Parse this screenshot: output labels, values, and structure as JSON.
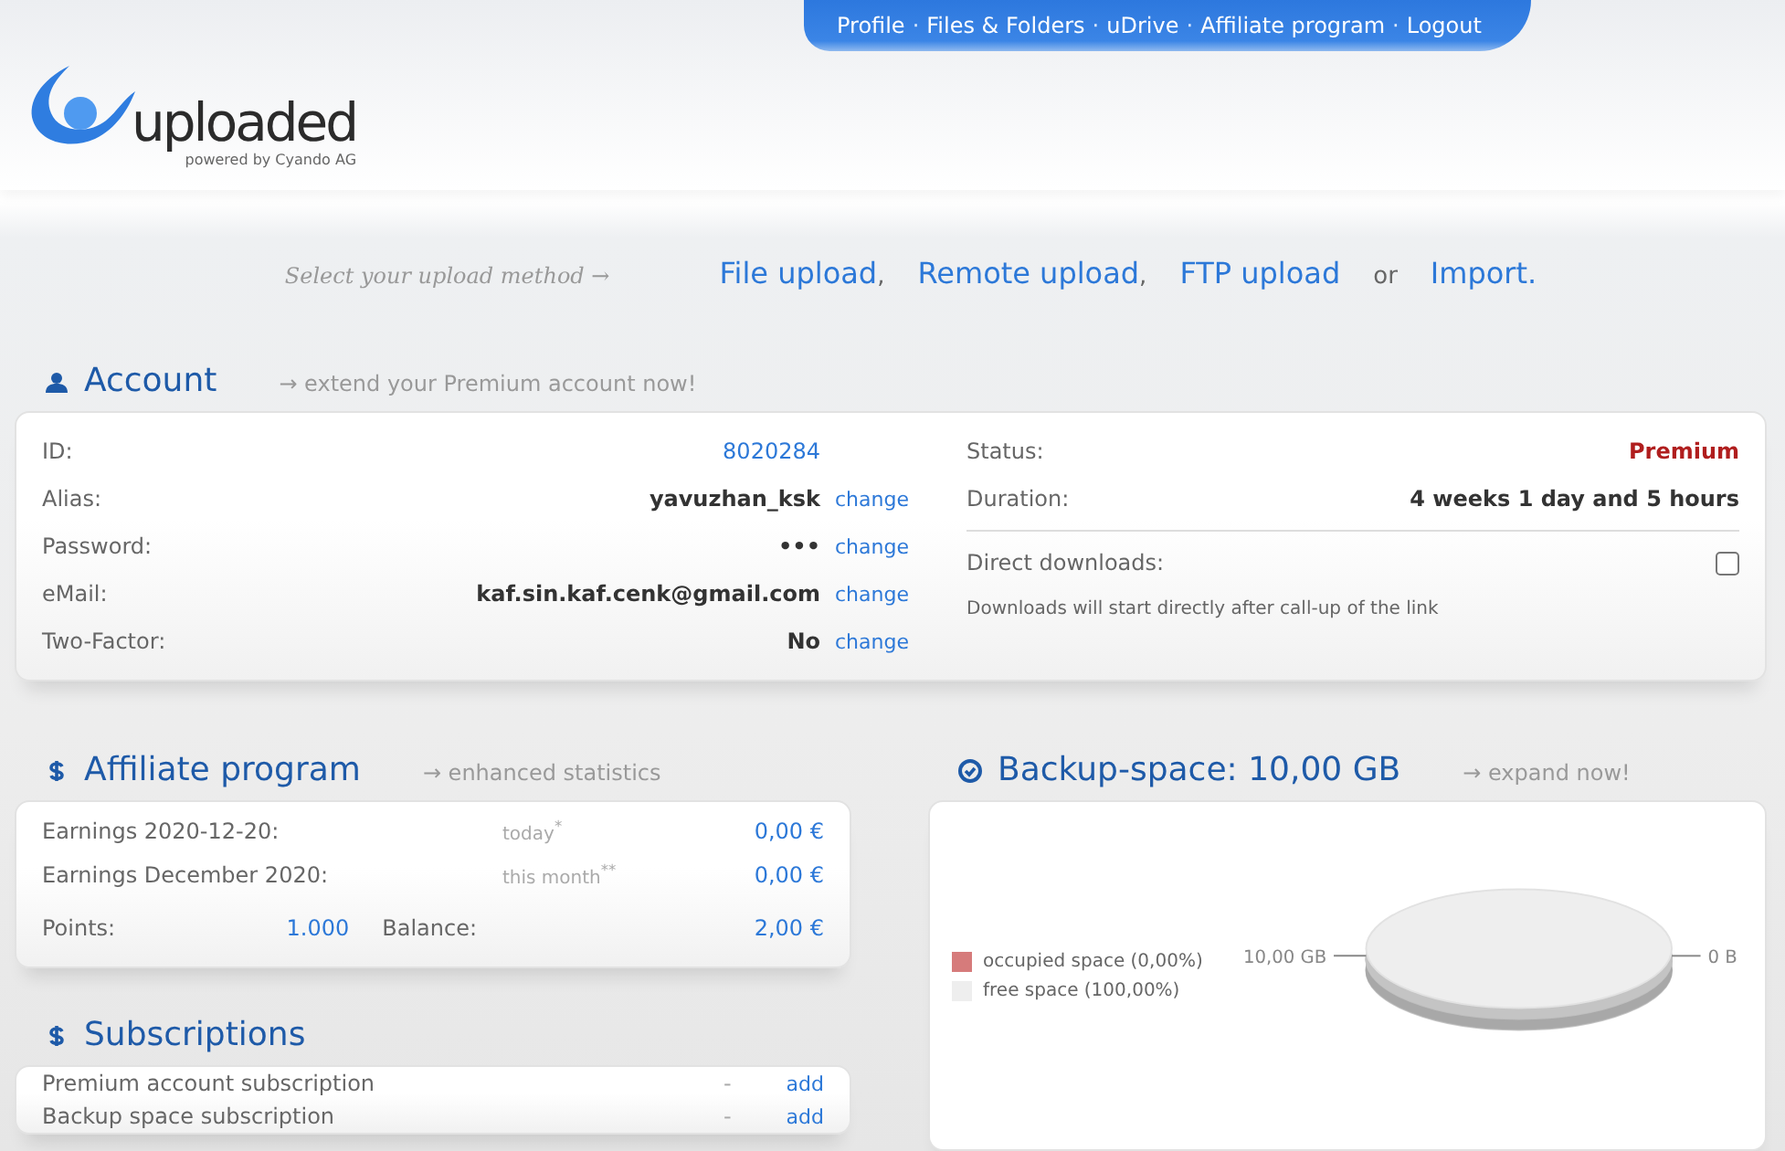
{
  "nav": {
    "links": [
      "Profile",
      "Files & Folders",
      "uDrive",
      "Affiliate program",
      "Logout"
    ],
    "separator": "·"
  },
  "logo": {
    "name": "uploaded",
    "tagline": "powered by Cyando AG"
  },
  "upload_methods": {
    "prompt": "Select your upload method →",
    "options": [
      {
        "label": "File upload",
        "separator": ","
      },
      {
        "label": "Remote upload",
        "separator": ","
      },
      {
        "label": "FTP upload",
        "separator": "or"
      },
      {
        "label": "Import."
      }
    ]
  },
  "account": {
    "title": "Account",
    "link": "→ extend your Premium account now!",
    "fields": [
      {
        "label": "ID:",
        "value": "8020284",
        "kind": "link"
      },
      {
        "label": "Alias:",
        "value": "yavuzhan_ksk",
        "kind": "text",
        "action": "change"
      },
      {
        "label": "Password:",
        "value": "•••",
        "kind": "text",
        "action": "change"
      },
      {
        "label": "eMail:",
        "value": "kaf.sin.kaf.cenk@gmail.com",
        "kind": "text",
        "action": "change"
      },
      {
        "label": "Two-Factor:",
        "value": "No",
        "kind": "text",
        "action": "change"
      }
    ],
    "status": {
      "label": "Status:",
      "value": "Premium"
    },
    "duration": {
      "label": "Duration:",
      "value": "4 weeks 1 day and 5 hours"
    },
    "direct_downloads": {
      "label": "Direct downloads:",
      "checked": false,
      "hint": "Downloads will start directly after call-up of the link"
    }
  },
  "affiliate": {
    "title": "Affiliate program",
    "link": "→ enhanced statistics",
    "rows": [
      {
        "label": "Earnings 2020-12-20:",
        "period": "today$^{*}$",
        "value": "0,00 €"
      },
      {
        "label": "Earnings December 2020:",
        "period": "this month$^{**}$",
        "value": "0,00 €"
      }
    ],
    "points": {
      "label": "Points:",
      "value": "1.000"
    },
    "balance": {
      "label": "Balance:",
      "value": "2,00 €"
    }
  },
  "subscriptions": {
    "title": "Subscriptions",
    "rows": [
      {
        "label": "Premium account subscription",
        "status": "-",
        "action": "add"
      },
      {
        "label": "Backup space subscription",
        "status": "-",
        "action": "add"
      }
    ]
  },
  "backup": {
    "title": "Backup-space: 10,00 GB",
    "link": "→ expand now!",
    "chart_data": {
      "type": "pie",
      "categories": [
        "occupied space (0,00%)",
        "free space (100,00%)"
      ],
      "values": [
        0,
        10
      ],
      "value_labels": [
        "0 B",
        "10,00 GB"
      ]
    },
    "legend": [
      {
        "color": "#d67b7b"
      },
      {
        "color": "#eeeeee"
      }
    ]
  }
}
